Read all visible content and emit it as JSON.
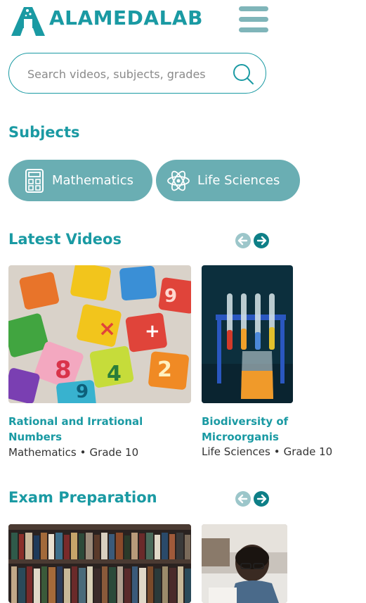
{
  "brand": {
    "name": "ALAMEDALAB"
  },
  "search": {
    "placeholder": "Search videos, subjects, grades"
  },
  "subjects": {
    "title": "Subjects",
    "items": [
      {
        "label": "Mathematics",
        "icon": "calculator-icon"
      },
      {
        "label": "Life Sciences",
        "icon": "atom-icon"
      }
    ]
  },
  "latest_videos": {
    "title": "Latest Videos",
    "cards": [
      {
        "title_line1": "Rational and Irrational",
        "title_line2": "Numbers",
        "subject": "Mathematics",
        "grade": "Grade 10"
      },
      {
        "title_line1": "Biodiversity of",
        "title_line2": "Microorganis",
        "subject": "Life Sciences",
        "grade": "Grade 10"
      }
    ]
  },
  "exam_preparation": {
    "title": "Exam Preparation"
  },
  "colors": {
    "brand": "#1a9aa3",
    "pill": "#6aaeb3",
    "menu": "#7fb5b9",
    "arrow_active": "#0e7f87",
    "arrow_inactive": "#9cc6ca"
  },
  "meta_separator": "•"
}
